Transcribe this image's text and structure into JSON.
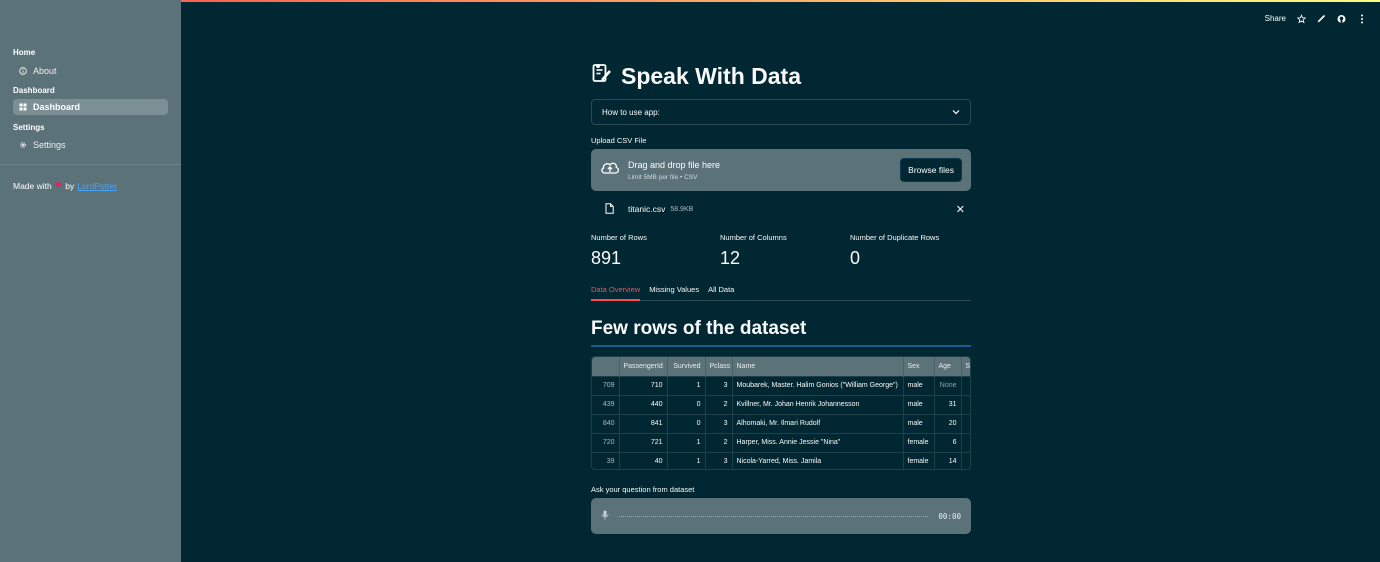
{
  "toolbar": {
    "share": "Share"
  },
  "sidebar": {
    "sections": [
      {
        "label": "Home",
        "items": [
          {
            "label": "About",
            "icon": "info-icon",
            "active": false
          }
        ]
      },
      {
        "label": "Dashboard",
        "items": [
          {
            "label": "Dashboard",
            "icon": "dashboard-icon",
            "active": true
          }
        ]
      },
      {
        "label": "Settings",
        "items": [
          {
            "label": "Settings",
            "icon": "gear-icon",
            "active": false
          }
        ]
      }
    ],
    "made_with": "Made with",
    "by": "by",
    "author": "LordPotter"
  },
  "main": {
    "title": "Speak With Data",
    "expander": "How to use app:",
    "upload": {
      "label": "Upload CSV File",
      "drag_text": "Drag and drop file here",
      "limit_text": "Limit 5MB per file • CSV",
      "browse": "Browse files",
      "file_name": "titanic.csv",
      "file_size": "58.9KB"
    },
    "metrics": [
      {
        "label": "Number of Rows",
        "value": "891"
      },
      {
        "label": "Number of Columns",
        "value": "12"
      },
      {
        "label": "Number of Duplicate Rows",
        "value": "0"
      }
    ],
    "tabs": [
      "Data Overview",
      "Missing Values",
      "All Data"
    ],
    "section_heading": "Few rows of the dataset",
    "table": {
      "columns": [
        "",
        "PassengerId",
        "Survived",
        "Pclass",
        "Name",
        "Sex",
        "Age",
        "Si"
      ],
      "rows": [
        [
          "709",
          "710",
          "1",
          "3",
          "Moubarek, Master. Halim Gonios (\"William George\")",
          "male",
          "None"
        ],
        [
          "439",
          "440",
          "0",
          "2",
          "Kvillner, Mr. Johan Henrik Johannesson",
          "male",
          "31"
        ],
        [
          "840",
          "841",
          "0",
          "3",
          "Alhomaki, Mr. Ilmari Rudolf",
          "male",
          "20"
        ],
        [
          "720",
          "721",
          "1",
          "2",
          "Harper, Miss. Annie Jessie \"Nina\"",
          "female",
          "6"
        ],
        [
          "39",
          "40",
          "1",
          "3",
          "Nicola-Yarred, Miss. Jamila",
          "female",
          "14"
        ]
      ]
    },
    "question_label": "Ask your question from dataset",
    "recorder_time": "00:00"
  },
  "colors": {
    "background": "#012733",
    "sidebar": "#5c7279",
    "accent": "#ff4b4b",
    "link": "#4ba3f5"
  }
}
